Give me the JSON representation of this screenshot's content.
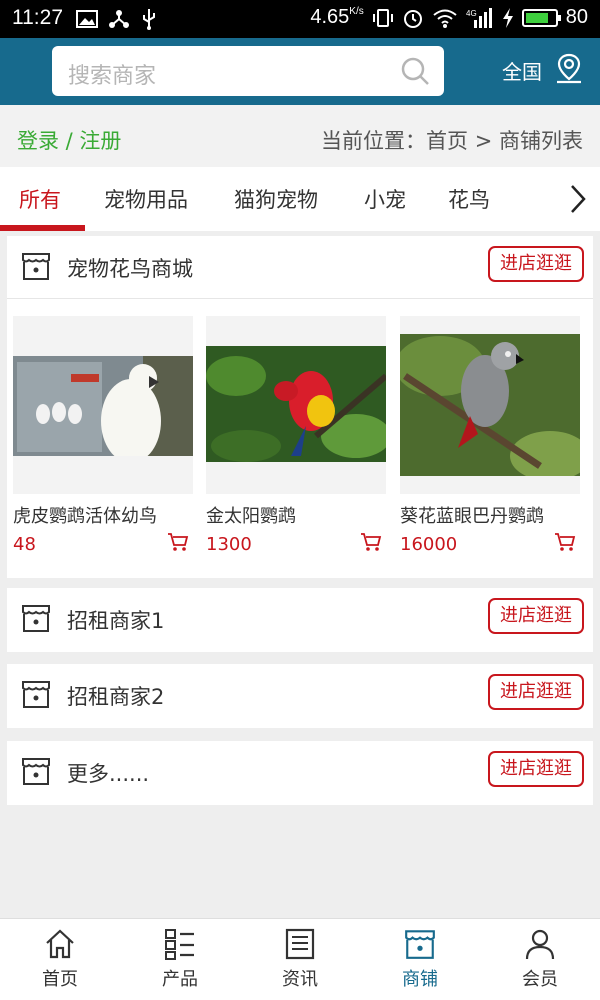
{
  "status_bar": {
    "time": "11:27",
    "speed": "4.65",
    "speed_unit": "K/s",
    "network": "4G",
    "battery": "80",
    "battery_level": 0.8
  },
  "header": {
    "search_placeholder": "搜索商家",
    "region": "全国"
  },
  "breadcrumb": {
    "login": "登录 / 注册",
    "position": "当前位置：首页 > 商铺列表"
  },
  "tabs": [
    "所有",
    "宠物用品",
    "猫狗宠物",
    "小宠",
    "花鸟"
  ],
  "stores": [
    {
      "name": "宠物花鸟商城",
      "button": "进店逛逛",
      "products": [
        {
          "name": "虎皮鹦鹉活体幼鸟",
          "price": "48"
        },
        {
          "name": "金太阳鹦鹉",
          "price": "1300"
        },
        {
          "name": "葵花蓝眼巴丹鹦鹉",
          "price": "16000"
        }
      ]
    },
    {
      "name": "招租商家1",
      "button": "进店逛逛"
    },
    {
      "name": "招租商家2",
      "button": "进店逛逛"
    },
    {
      "name": "更多......",
      "button": "进店逛逛"
    }
  ],
  "bottom_nav": [
    {
      "label": "首页",
      "icon": "home-icon"
    },
    {
      "label": "产品",
      "icon": "list-icon"
    },
    {
      "label": "资讯",
      "icon": "news-icon"
    },
    {
      "label": "商铺",
      "icon": "store-icon"
    },
    {
      "label": "会员",
      "icon": "user-icon"
    }
  ],
  "colors": {
    "header": "#176a8d",
    "accent_red": "#c8161d",
    "login_green": "#3aaa35"
  }
}
